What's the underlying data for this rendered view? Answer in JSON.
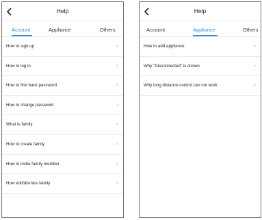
{
  "left_screen": {
    "title": "Help",
    "tabs": [
      {
        "label": "Account",
        "active": true
      },
      {
        "label": "Appliance",
        "active": false
      },
      {
        "label": "Others",
        "active": false
      }
    ],
    "items": [
      {
        "label": "How to sign up"
      },
      {
        "label": "How to log in"
      },
      {
        "label": "How to find back password"
      },
      {
        "label": "How to change password"
      },
      {
        "label": "What is family"
      },
      {
        "label": "How to create family"
      },
      {
        "label": "How to invite family member"
      },
      {
        "label": "How edit/dismiss family"
      }
    ]
  },
  "right_screen": {
    "title": "Help",
    "tabs": [
      {
        "label": "Account",
        "active": false
      },
      {
        "label": "Appliance",
        "active": true
      },
      {
        "label": "Others",
        "active": false
      }
    ],
    "items": [
      {
        "label": "How to add appliance"
      },
      {
        "label": "Why \"Disconnected\" is shown"
      },
      {
        "label": "Why long distance control can not work"
      }
    ]
  },
  "chevron_glyph": ">",
  "accent_color": "#3b8ed8"
}
